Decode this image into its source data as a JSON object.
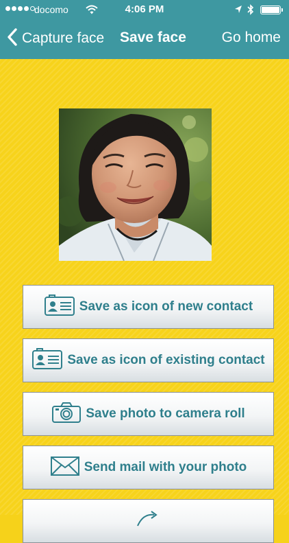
{
  "status_bar": {
    "carrier": "docomo",
    "time": "4:06 PM"
  },
  "nav": {
    "back_label": "Capture face",
    "title": "Save face",
    "home_label": "Go home"
  },
  "actions": [
    {
      "label": "Save as icon of new contact",
      "icon": "contact-card-icon"
    },
    {
      "label": "Save as icon of existing contact",
      "icon": "contact-card-icon"
    },
    {
      "label": "Save photo to camera roll",
      "icon": "camera-icon"
    },
    {
      "label": "Send mail with your photo",
      "icon": "envelope-icon"
    }
  ],
  "colors": {
    "header": "#3e98a1",
    "background": "#f7d31b",
    "button_text": "#2f7f8c"
  }
}
